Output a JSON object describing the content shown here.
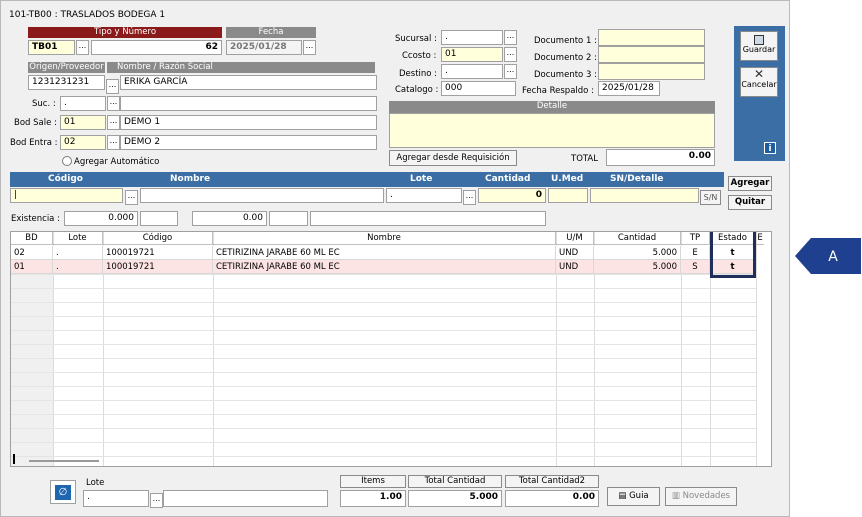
{
  "window": {
    "title": "101-TB00 : TRASLADOS BODEGA 1"
  },
  "header": {
    "tipo_numero_label": "Tipo y Número",
    "fecha_label": "Fecha",
    "tipo": "TB01",
    "numero": "62",
    "fecha": "2025/01/28",
    "origen_label": "Origen/Proveedor",
    "nombre_label": "Nombre / Razón Social",
    "origen": "1231231231",
    "nombre": "ERIKA GARCÍA",
    "suc_label": "Suc. :",
    "suc": ".",
    "bod_sale_label": "Bod Sale :",
    "bod_sale": "01",
    "bod_sale_nombre": "DEMO 1",
    "bod_entra_label": "Bod Entra :",
    "bod_entra": "02",
    "bod_entra_nombre": "DEMO 2",
    "agregar_auto_label": "Agregar Automático"
  },
  "center": {
    "sucursal_label": "Sucursal :",
    "sucursal": ".",
    "ccosto_label": "Ccosto :",
    "ccosto": "01",
    "destino_label": "Destino :",
    "destino": ".",
    "catalogo_label": "Catalogo :",
    "catalogo": "000",
    "doc1_label": "Documento 1 :",
    "doc2_label": "Documento 2 :",
    "doc3_label": "Documento 3 :",
    "fecha_respaldo_label": "Fecha Respaldo :",
    "fecha_respaldo": "2025/01/28",
    "detalle_label": "Detalle",
    "agregar_requisicion": "Agregar desde Requisición",
    "total_label": "TOTAL",
    "total": "0.00"
  },
  "sidebar": {
    "guardar": "Guardar",
    "cancelar": "Cancelar",
    "info": "i"
  },
  "entry": {
    "codigo_label": "Código",
    "nombre_label": "Nombre",
    "lote_label": "Lote",
    "cantidad_label": "Cantidad",
    "umed_label": "U.Med",
    "sn_label": "SN/Detalle",
    "lote": ".",
    "cantidad": "0",
    "sn_btn": "S/N",
    "agregar": "Agregar",
    "quitar": "Quitar",
    "existencia_label": "Existencia :",
    "existencia": "0.000",
    "valor": "0.00"
  },
  "grid": {
    "columns": [
      "BD",
      "Lote",
      "Código",
      "Nombre",
      "U/M",
      "Cantidad",
      "TP",
      "Estado",
      "E"
    ],
    "rows": [
      {
        "bd": "02",
        "lote": ".",
        "codigo": "100019721",
        "nombre": "CETIRIZINA JARABE 60 ML EC",
        "um": "UND",
        "cantidad": "5.000",
        "tp": "E",
        "estado": "t"
      },
      {
        "bd": "01",
        "lote": ".",
        "codigo": "100019721",
        "nombre": "CETIRIZINA JARABE 60 ML EC",
        "um": "UND",
        "cantidad": "5.000",
        "tp": "S",
        "estado": "t"
      }
    ]
  },
  "footer": {
    "lote_label": "Lote",
    "lote": ".",
    "items_label": "Items",
    "items": "1.00",
    "total_cantidad_label": "Total Cantidad",
    "total_cantidad": "5.000",
    "total_cantidad2_label": "Total Cantidad2",
    "total_cantidad2": "0.00",
    "guia": "Guia",
    "novedades": "Novedades"
  },
  "annotation": {
    "marker": "A"
  },
  "colors": {
    "accent_blue": "#3a6ea5",
    "header_red": "#8b1a1a",
    "highlight_border": "#1f2f5a",
    "row_pink": "#fde4e4",
    "marker_blue": "#1f3f8f"
  }
}
